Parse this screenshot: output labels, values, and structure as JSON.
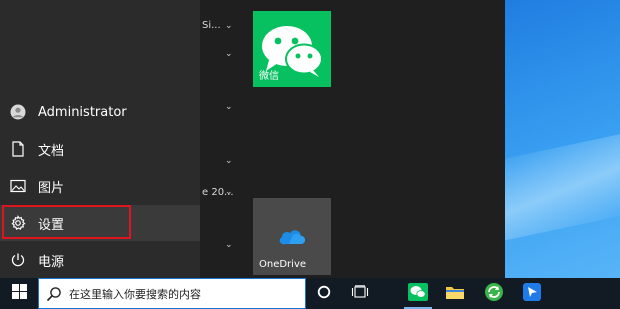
{
  "user": {
    "name": "Administrator"
  },
  "rail": {
    "documents": "文档",
    "pictures": "图片",
    "settings": "设置",
    "power": "电源"
  },
  "app_list_fragments": {
    "item1": "Si...",
    "item2": "e 20..."
  },
  "tiles": {
    "wechat": "微信",
    "onedrive": "OneDrive"
  },
  "taskbar": {
    "search_placeholder": "在这里输入你要搜索的内容"
  },
  "colors": {
    "highlight": "#e0141e",
    "wechat_green": "#07c160",
    "start_bg": "#1f1f1f"
  }
}
